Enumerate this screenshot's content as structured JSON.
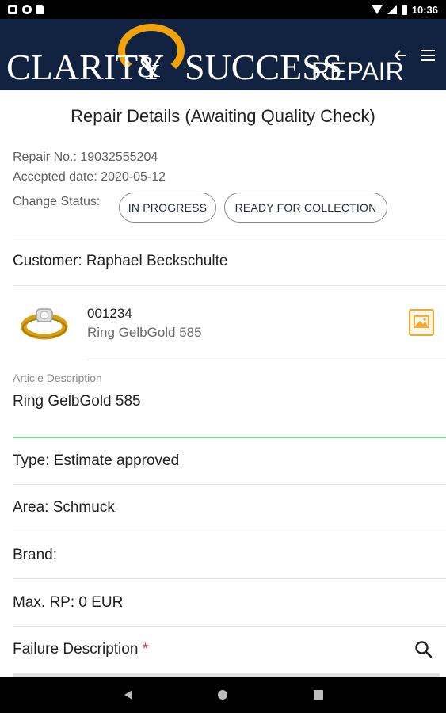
{
  "statusbar": {
    "time": "10:36"
  },
  "appbar": {
    "brand_clarity": "CLARITY",
    "brand_amp": "&",
    "brand_success": "SUCCESS",
    "brand_repair": "REPAIR",
    "back_icon": "arrow-back-icon",
    "menu_icon": "hamburger-menu-icon"
  },
  "page": {
    "title": "Repair Details (Awaiting Quality Check)",
    "repair_no": "Repair No.: 19032555204",
    "accepted_date": "Accepted date: 2020-05-12",
    "change_status_label": "Change Status:",
    "status_buttons": [
      "IN PROGRESS",
      "READY FOR COLLECTION"
    ],
    "customer": "Customer: Raphael Beckschulte",
    "article": {
      "code": "001234",
      "name": "Ring GelbGold 585",
      "image_icon": "image-gallery-icon"
    },
    "article_description_label": "Article Description",
    "article_description_value": "Ring GelbGold 585",
    "type": "Type: Estimate approved",
    "area": "Area: Schmuck",
    "brand": "Brand:",
    "max_rp": "Max. RP: 0 EUR",
    "failure_description_label": "Failure Description",
    "required_marker": "*",
    "search_icon": "search-icon"
  },
  "colors": {
    "appbar": "#122241",
    "accent_gold": "#f0a30a",
    "underline_green": "#7bd88f",
    "required_red": "#e53935"
  }
}
